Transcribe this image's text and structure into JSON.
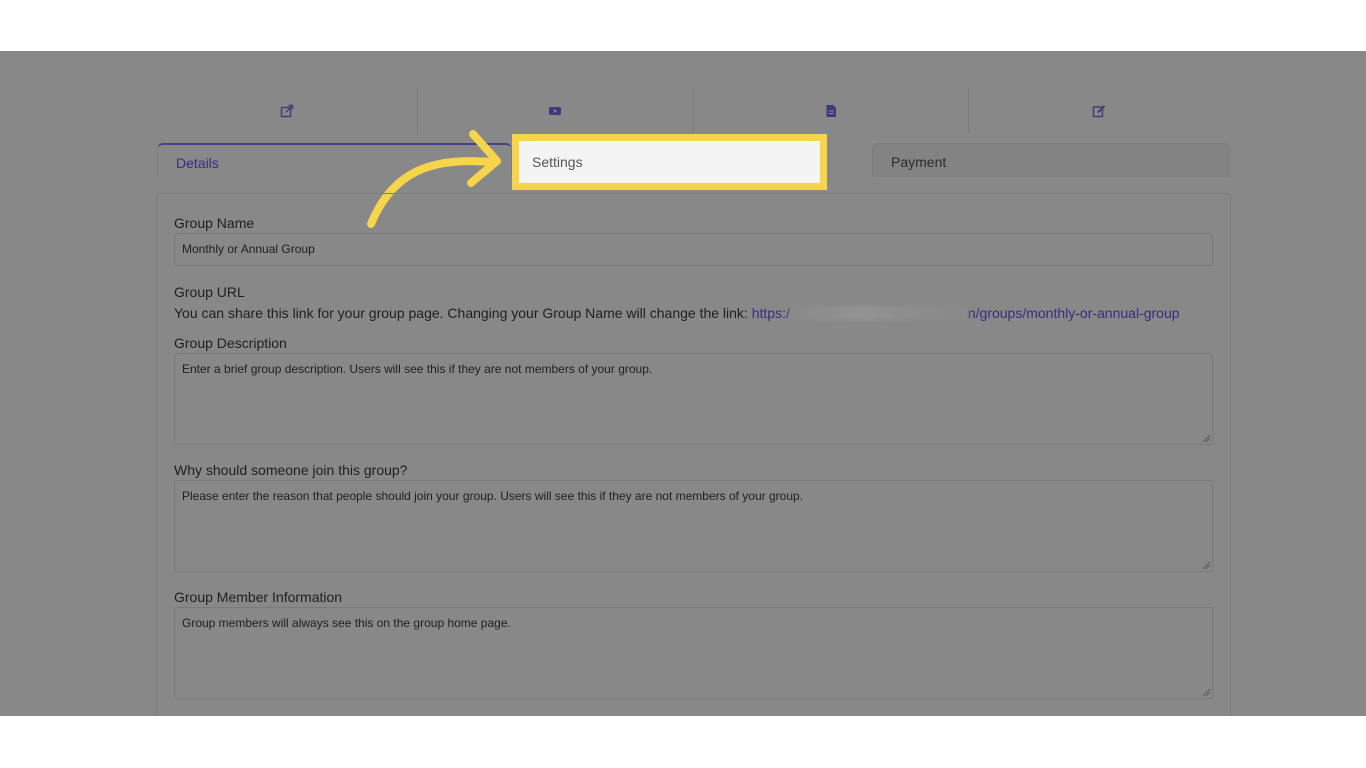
{
  "toolbar": {
    "icons": [
      "external-link-icon",
      "video-icon",
      "document-icon",
      "edit-icon"
    ]
  },
  "tabs": [
    {
      "label": "Details",
      "active": true
    },
    {
      "label": "Settings",
      "active": false
    },
    {
      "label": "Payment",
      "active": false
    }
  ],
  "highlight": {
    "label": "Settings",
    "color": "#f7d54a"
  },
  "form": {
    "group_name_label": "Group Name",
    "group_name_value": "Monthly or Annual Group",
    "group_url_label": "Group URL",
    "group_url_text": "You can share this link for your group page. Changing your Group Name will change the link:",
    "group_url_link_start": "https:/",
    "group_url_link_end": "n/groups/monthly-or-annual-group",
    "description_label": "Group Description",
    "description_placeholder": "Enter a brief group description.  Users will see this if they are not members of your group.",
    "why_join_label": "Why should someone join this group?",
    "why_join_placeholder": "Please enter the reason that people should join your group.  Users will see this if they are not members of your group.",
    "member_info_label": "Group Member Information",
    "member_info_placeholder": "Group members will always see this on the group home page."
  },
  "colors": {
    "accent": "#3c2b80",
    "overlay": "#888888",
    "highlight": "#f7d54a"
  }
}
